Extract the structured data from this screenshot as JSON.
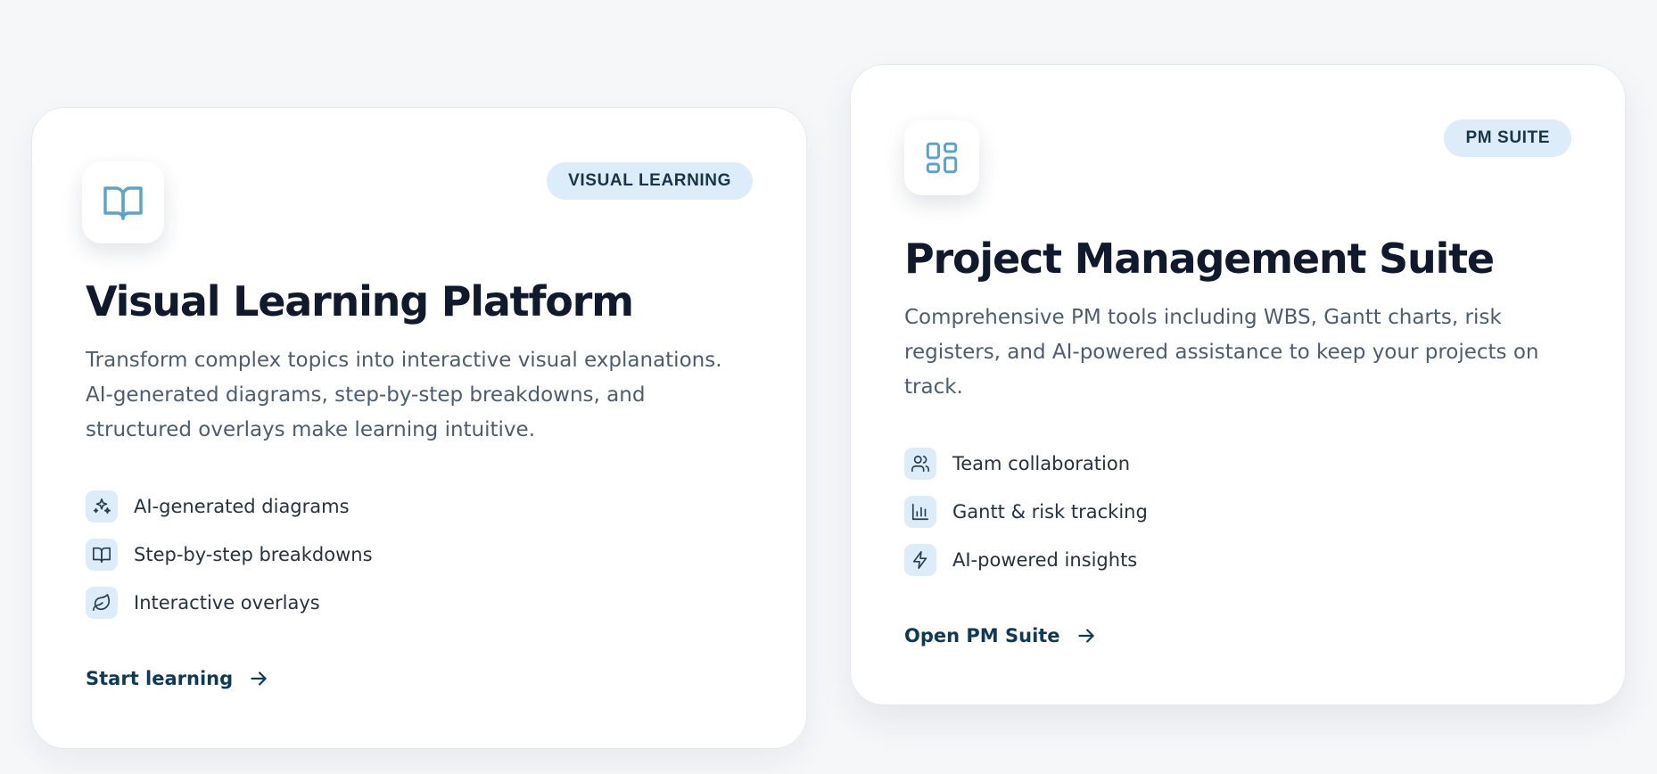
{
  "cards": [
    {
      "badge": "VISUAL LEARNING",
      "title": "Visual Learning Platform",
      "description": "Transform complex topics into interactive visual explanations. AI-generated diagrams, step-by-step breakdowns, and structured overlays make learning intuitive.",
      "icon": "book-open-icon",
      "features": [
        {
          "label": "AI-generated diagrams",
          "icon": "sparkles-icon"
        },
        {
          "label": "Step-by-step breakdowns",
          "icon": "book-open-icon"
        },
        {
          "label": "Interactive overlays",
          "icon": "leaf-icon"
        }
      ],
      "cta": "Start learning"
    },
    {
      "badge": "PM SUITE",
      "title": "Project Management Suite",
      "description": "Comprehensive PM tools including WBS, Gantt charts, risk registers, and AI-powered assistance to keep your projects on track.",
      "icon": "layout-dashboard-icon",
      "features": [
        {
          "label": "Team collaboration",
          "icon": "users-icon"
        },
        {
          "label": "Gantt & risk tracking",
          "icon": "bar-chart-icon"
        },
        {
          "label": "AI-powered insights",
          "icon": "zap-icon"
        }
      ],
      "cta": "Open PM Suite"
    }
  ],
  "colors": {
    "accent_icon": "#5ba3c9",
    "badge_bg": "#dcecf8",
    "title": "#101a2c",
    "body_text": "#4e5d6d",
    "cta": "#0e3a56"
  }
}
